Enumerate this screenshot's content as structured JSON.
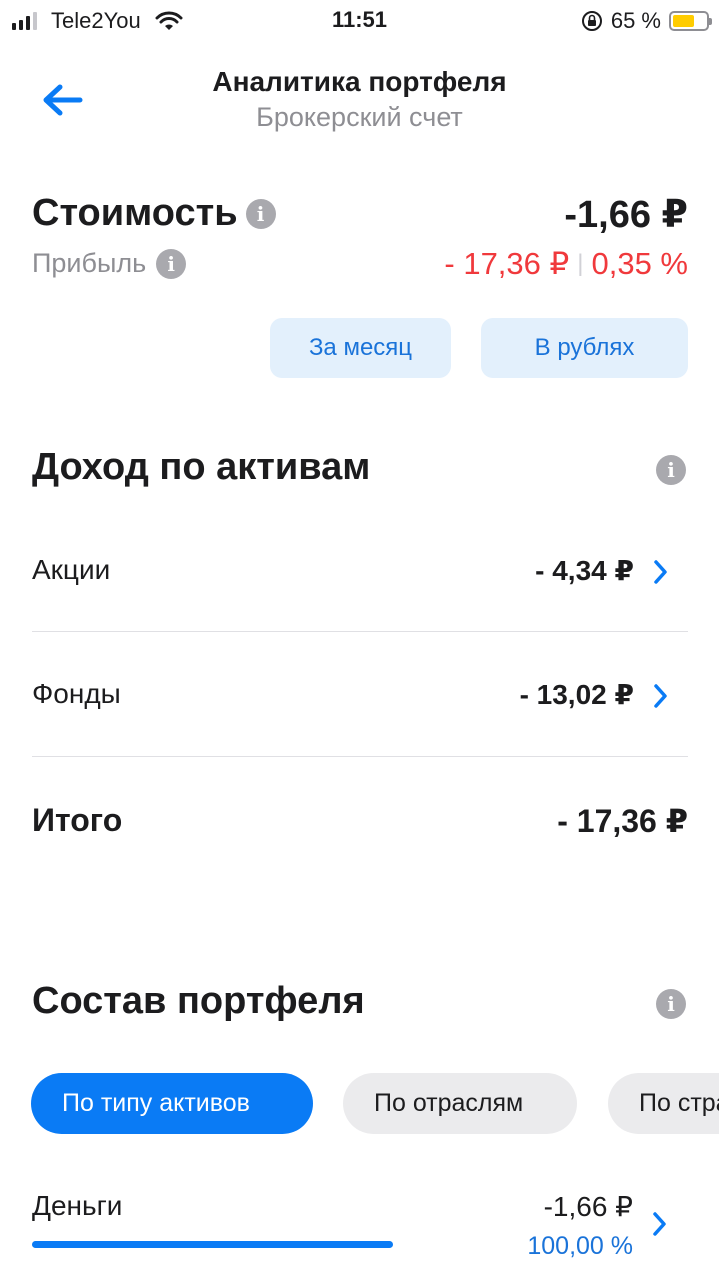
{
  "status_bar": {
    "carrier": "Tele2You",
    "time": "11:51",
    "battery_percent": "65 %",
    "battery_level": 0.65,
    "battery_color": "#ffcc00"
  },
  "nav": {
    "back_icon": "arrow-left-icon",
    "title": "Аналитика портфеля",
    "subtitle": "Брокерский счет"
  },
  "summary": {
    "value_label": "Стоимость",
    "value": "-1,66 ₽",
    "profit_label": "Прибыль",
    "profit_amount": "- 17,36 ₽",
    "profit_separator": "|",
    "profit_percent": "0,35 %",
    "profit_color": "#f0393c"
  },
  "filters": {
    "period": "За месяц",
    "currency": "В рублях"
  },
  "income": {
    "title": "Доход по активам",
    "rows": [
      {
        "name": "Акции",
        "value": "- 4,34 ₽"
      },
      {
        "name": "Фонды",
        "value": "- 13,02 ₽"
      }
    ],
    "total_label": "Итого",
    "total_value": "- 17,36 ₽"
  },
  "composition": {
    "title": "Состав портфеля",
    "tabs": [
      {
        "label": "По типу активов",
        "active": true
      },
      {
        "label": "По отраслям",
        "active": false
      },
      {
        "label": "По странам",
        "active": false
      }
    ],
    "items": [
      {
        "name": "Деньги",
        "value": "-1,66 ₽",
        "percent": "100,00 %",
        "share": 1.0
      }
    ]
  },
  "colors": {
    "accent": "#0a7bf5",
    "link_blue": "#1a73d9",
    "negative": "#f0393c",
    "chip_bg": "#e3f0fc"
  }
}
